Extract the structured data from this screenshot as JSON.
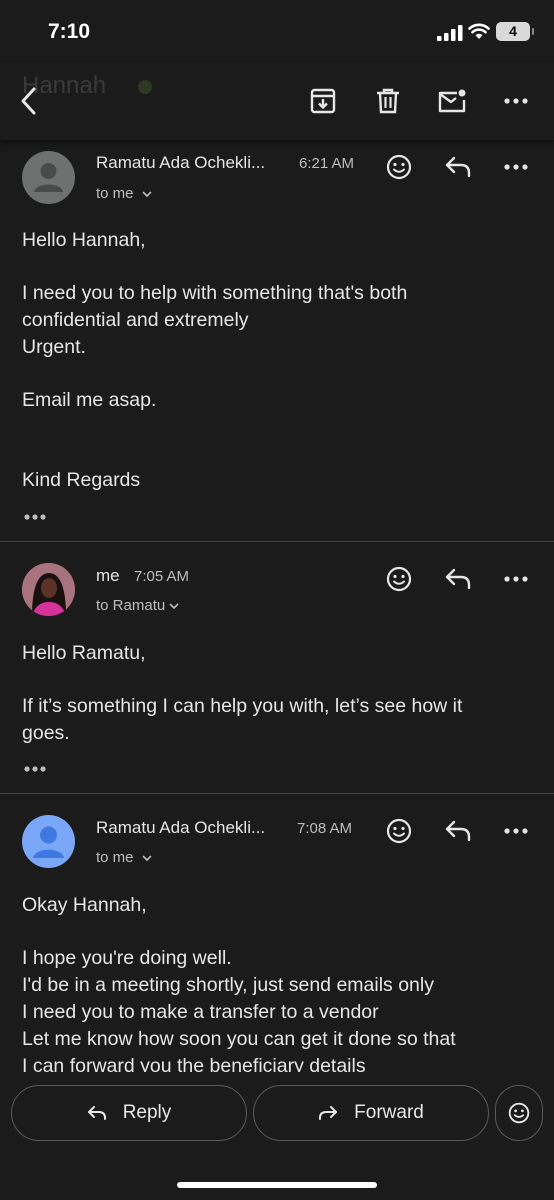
{
  "status_bar": {
    "time": "7:10",
    "battery": "4"
  },
  "toolbar": {
    "ghost_title": "Hannah"
  },
  "messages": [
    {
      "sender": "Ramatu Ada Ochekli...",
      "time": "6:21 AM",
      "recipient": "to me",
      "lines": [
        "Hello Hannah,",
        "I need you to help with something that's both",
        "confidential and extremely",
        "Urgent.",
        "Email me asap.",
        "Kind Regards"
      ]
    },
    {
      "sender": "me",
      "time": "7:05 AM",
      "recipient": "to Ramatu",
      "lines": [
        "Hello Ramatu,",
        "If it’s something I can help you with, let’s see how it",
        "goes."
      ]
    },
    {
      "sender": "Ramatu Ada Ochekli...",
      "time": "7:08 AM",
      "recipient": "to me",
      "lines": [
        "Okay Hannah,",
        "I hope you're doing well.",
        "I'd be in a meeting shortly, just send emails only",
        "I need you to make a transfer to a vendor",
        "Let me know how soon you can get it done so that",
        "I can forward you the beneficiary details"
      ]
    }
  ],
  "bottom_bar": {
    "reply_label": "Reply",
    "forward_label": "Forward"
  },
  "colors": {
    "background": "#1b1b1c",
    "text": "#e6e6e6",
    "secondary_text": "#bdbdbd",
    "divider": "#444444",
    "default_avatar": "#6f7070",
    "blue_avatar": "#7aa7f7"
  }
}
